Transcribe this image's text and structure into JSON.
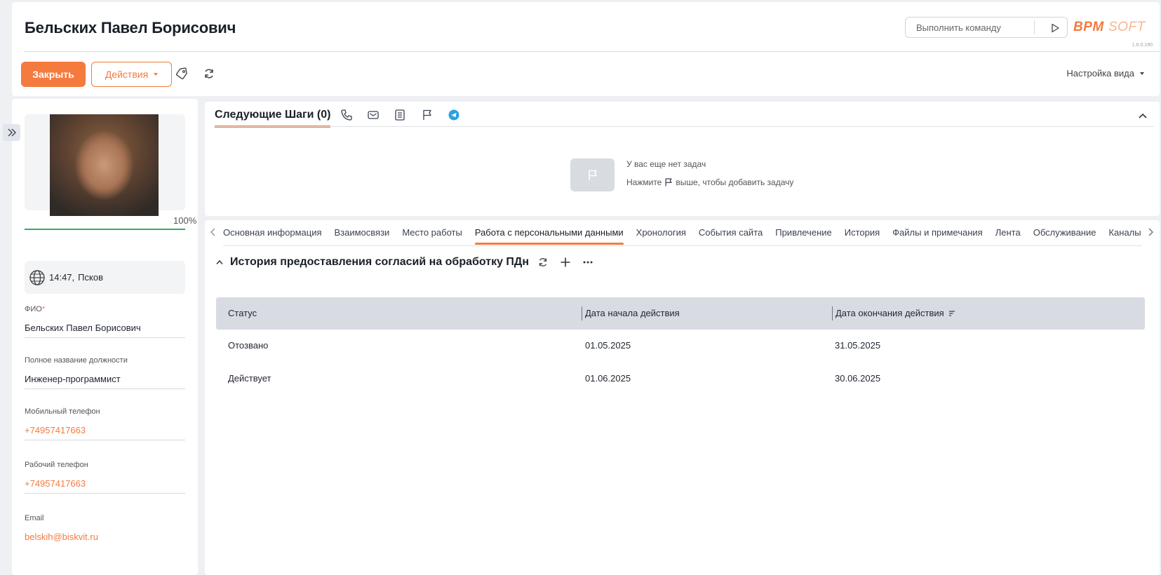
{
  "header": {
    "title": "Бельских Павел Борисович",
    "command_placeholder": "Выполнить команду",
    "logo_text": "BPMSOFT",
    "version": "1.6.0.190",
    "close_label": "Закрыть",
    "actions_label": "Действия",
    "view_settings_label": "Настройка вида"
  },
  "profile": {
    "completeness": "100%",
    "completeness_value": 100,
    "time": "14:47,",
    "city": "Псков",
    "fields": [
      {
        "label": "ФИО",
        "required": "*",
        "value": "Бельских Павел Борисович"
      },
      {
        "label": "Полное название должности",
        "value": "Инженер-программист"
      },
      {
        "label": "Мобильный телефон",
        "value": "+74957417663"
      },
      {
        "label": "Рабочий телефон",
        "value": "+74957417663"
      },
      {
        "label": "Email",
        "value": "belskih@biskvit.ru"
      }
    ]
  },
  "next_steps": {
    "title": "Следующие Шаги (0)",
    "empty_line1": "У вас еще нет задач",
    "empty_line2_before": "Нажмите",
    "empty_line2_after": "выше, чтобы добавить задачу"
  },
  "tabs": [
    "Основная информация",
    "Взаимосвязи",
    "Место работы",
    "Работа с персональными данными",
    "Хронология",
    "События сайта",
    "Привлечение",
    "История",
    "Файлы и примечания",
    "Лента",
    "Обслуживание",
    "Каналы коммуникации"
  ],
  "active_tab": 3,
  "consents": {
    "title": "История предоставления согласий на обработку ПДн",
    "columns": [
      "Статус",
      "Дата начала действия",
      "Дата окончания действия"
    ],
    "rows": [
      [
        "Отозвано",
        "01.05.2025",
        "31.05.2025"
      ],
      [
        "Действует",
        "01.06.2025",
        "30.06.2025"
      ]
    ]
  },
  "colors": {
    "accent": "#f47a3e",
    "progress": "#2db05c",
    "telegram": "#2aa3de"
  }
}
